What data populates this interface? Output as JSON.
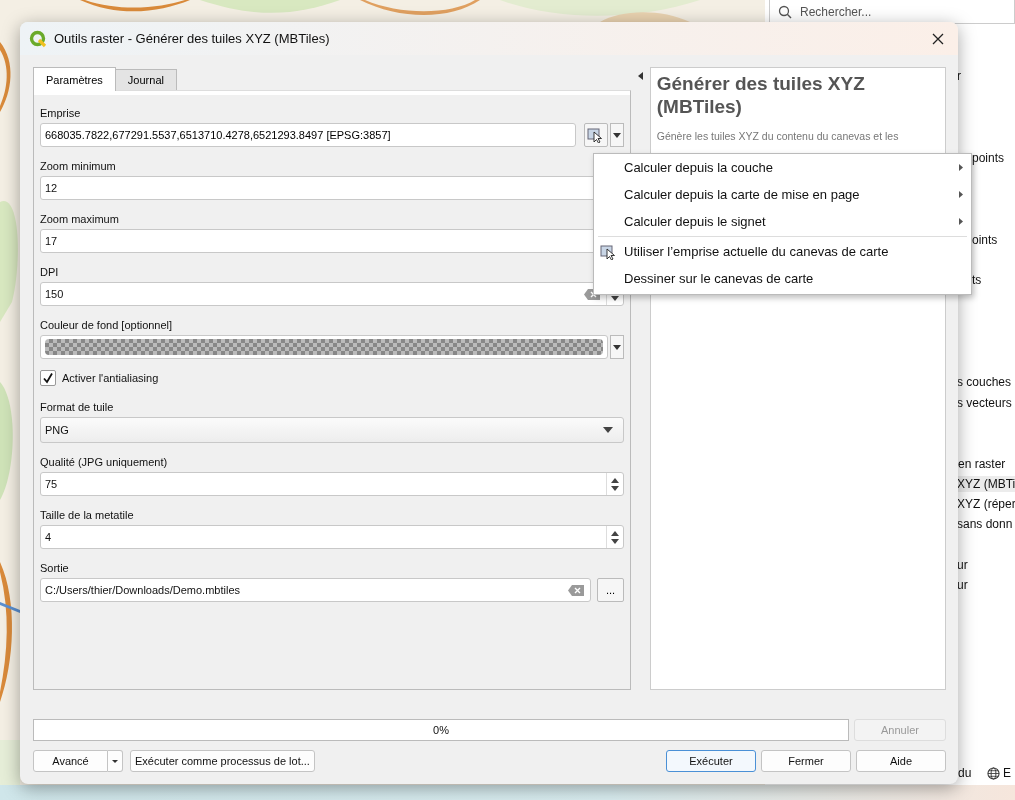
{
  "background": {
    "search": {
      "placeholder": "Rechercher..."
    },
    "panel_items": [
      {
        "label": "r",
        "selected": false
      },
      {
        "label": "points",
        "selected": false
      },
      {
        "label": "oints",
        "selected": false
      },
      {
        "label": "ts",
        "selected": false
      },
      {
        "label": "s couches",
        "selected": false
      },
      {
        "label": "s vecteurs",
        "selected": false
      },
      {
        "label": "en raster",
        "selected": false
      },
      {
        "label": "XYZ (MBTi",
        "selected": true
      },
      {
        "label": "XYZ (réper",
        "selected": false
      },
      {
        "label": "sans donn",
        "selected": false
      },
      {
        "label": "ur",
        "selected": false
      },
      {
        "label": "ur",
        "selected": false
      }
    ],
    "status_items": [
      "du",
      "E"
    ]
  },
  "dialog": {
    "title": "Outils raster - Générer des tuiles XYZ (MBTiles)",
    "tabs": [
      {
        "label": "Paramètres",
        "selected": true
      },
      {
        "label": "Journal",
        "selected": false
      }
    ],
    "params": [
      {
        "kind": "extent",
        "label": "Emprise",
        "value": "668035.7822,677291.5537,6513710.4278,6521293.8497 [EPSG:3857]"
      },
      {
        "kind": "spin",
        "label": "Zoom minimum",
        "value": "12"
      },
      {
        "kind": "spin",
        "label": "Zoom maximum",
        "value": "17"
      },
      {
        "kind": "spin",
        "label": "DPI",
        "value": "150",
        "clear": true
      },
      {
        "kind": "color",
        "label": "Couleur de fond [optionnel]"
      },
      {
        "kind": "checkbox",
        "label": "Activer l'antialiasing",
        "checked": true
      },
      {
        "kind": "combo",
        "label": "Format de tuile",
        "value": "PNG"
      },
      {
        "kind": "spin",
        "label": "Qualité (JPG uniquement)",
        "value": "75"
      },
      {
        "kind": "spin",
        "label": "Taille de la metatile",
        "value": "4"
      },
      {
        "kind": "file",
        "label": "Sortie",
        "value": "C:/Users/thier/Downloads/Demo.mbtiles",
        "button": "..."
      }
    ],
    "help": {
      "title": "Générer des tuiles XYZ (MBTiles)",
      "description": "Génère les tuiles XYZ du contenu du canevas et les"
    },
    "progress": {
      "level": 0,
      "text": "0%"
    },
    "cancel": {
      "label": "Annuler",
      "disabled": true
    },
    "left_buttons": [
      {
        "label": "Avancé",
        "kind": "dropdown"
      },
      {
        "label": "Exécuter comme processus de lot...",
        "kind": "plain"
      }
    ],
    "right_buttons": [
      {
        "label": "Exécuter",
        "default": true
      },
      {
        "label": "Fermer",
        "default": false
      },
      {
        "label": "Aide",
        "default": false
      }
    ],
    "menu": {
      "items": [
        {
          "kind": "submenu",
          "label": "Calculer depuis la couche"
        },
        {
          "kind": "submenu",
          "label": "Calculer depuis la carte de mise en page"
        },
        {
          "kind": "submenu",
          "label": "Calculer depuis le signet"
        },
        {
          "kind": "separator"
        },
        {
          "kind": "icon",
          "label": "Utiliser l’emprise actuelle du canevas de carte"
        },
        {
          "kind": "plain",
          "label": "Dessiner sur le canevas de carte"
        }
      ]
    }
  }
}
